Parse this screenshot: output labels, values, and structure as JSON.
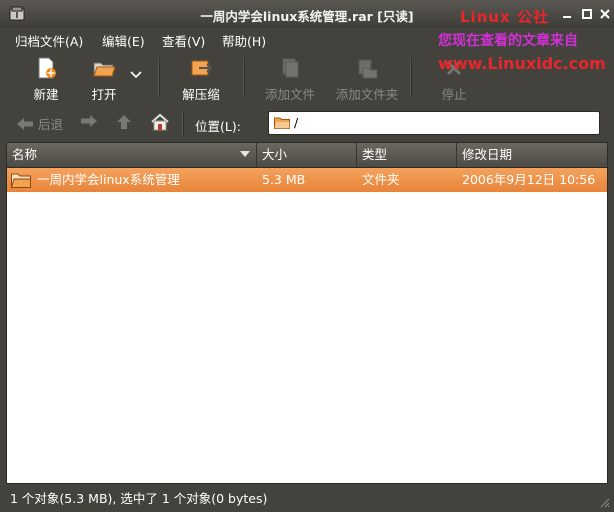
{
  "window": {
    "title": "一周内学会linux系统管理.rar [只读]",
    "buttons": [
      "_",
      "□",
      "✕"
    ]
  },
  "watermark": {
    "line1": "Linux 公社",
    "line2": "您现在查看的文章来自",
    "line3": "www.Linuxidc.com"
  },
  "menubar": {
    "items": [
      {
        "label": "归档文件(A)"
      },
      {
        "label": "编辑(E)"
      },
      {
        "label": "查看(V)"
      },
      {
        "label": "帮助(H)"
      }
    ]
  },
  "toolbar": {
    "new_label": "新建",
    "open_label": "打开",
    "extract_label": "解压缩",
    "add_file_label": "添加文件",
    "add_folder_label": "添加文件夹",
    "stop_label": "停止"
  },
  "locationbar": {
    "back_label": "后退",
    "location_label": "位置(L):",
    "path": "/"
  },
  "list": {
    "columns": [
      "名称",
      "大小",
      "类型",
      "修改日期"
    ],
    "rows": [
      {
        "name": "一周内学会linux系统管理",
        "size": "5.3 MB",
        "type": "文件夹",
        "modified": "2006年9月12日 10:56"
      }
    ]
  },
  "statusbar": {
    "text": "1 个对象(5.3 MB), 选中了 1 个对象(0 bytes)"
  },
  "colors": {
    "selection": "#e8843a",
    "window_bg": "#44423d"
  }
}
